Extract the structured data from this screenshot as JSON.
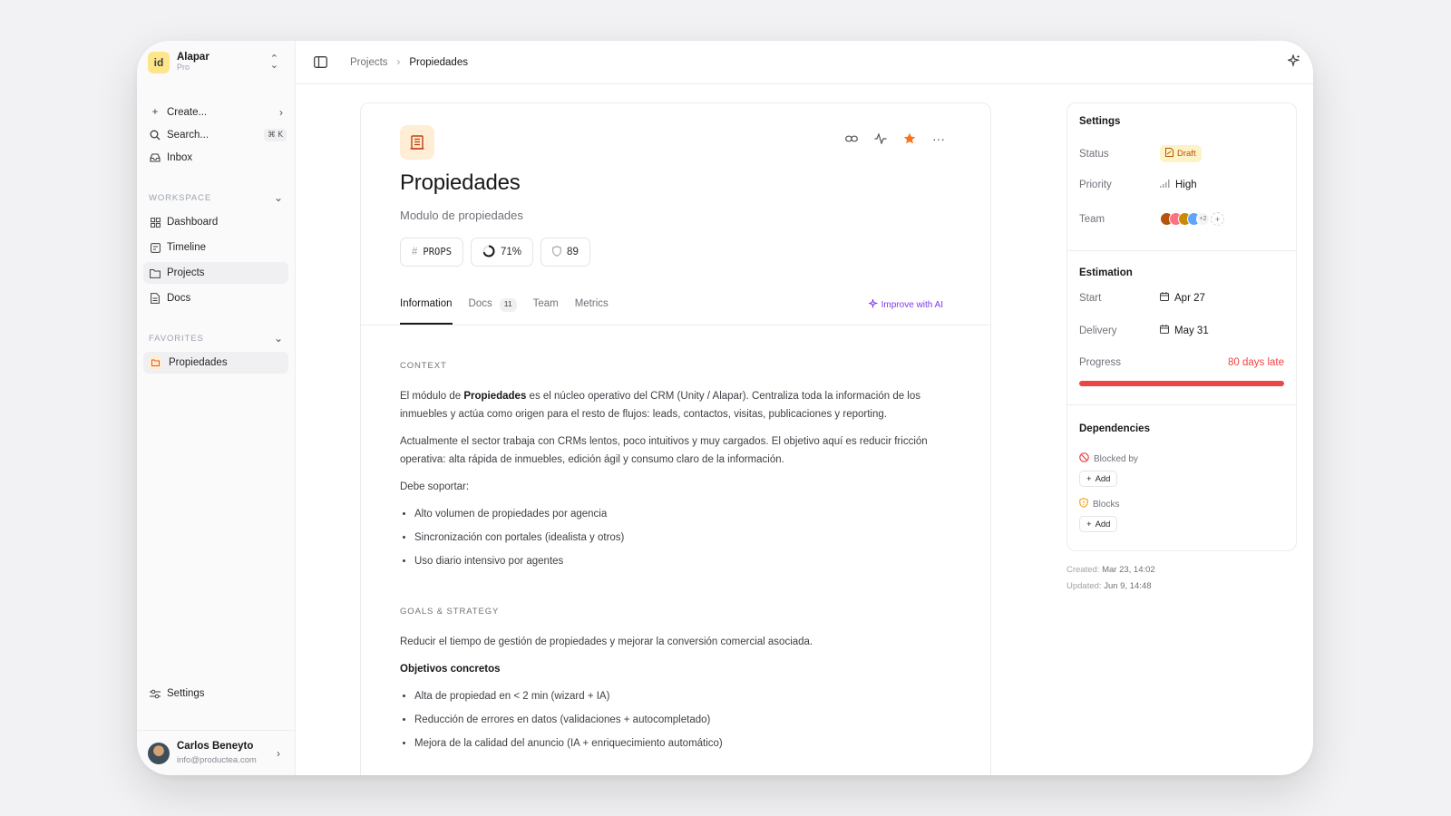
{
  "workspace": {
    "logo": "id",
    "name": "Alapar",
    "plan": "Pro"
  },
  "nav": {
    "create": "Create...",
    "search": "Search...",
    "search_kbd": "⌘ K",
    "inbox": "Inbox"
  },
  "workspace_section": {
    "label": "WORKSPACE",
    "items": [
      "Dashboard",
      "Timeline",
      "Projects",
      "Docs"
    ]
  },
  "favorites_section": {
    "label": "FAVORITES",
    "items": [
      "Propiedades"
    ]
  },
  "settings_label": "Settings",
  "user": {
    "name": "Carlos Beneyto",
    "email": "info@productea.com"
  },
  "breadcrumb": {
    "parent": "Projects",
    "current": "Propiedades"
  },
  "doc": {
    "title": "Propiedades",
    "subtitle": "Modulo de propiedades",
    "chips": {
      "code": "PROPS",
      "progress": "71%",
      "progress_value": 0.71,
      "score": "89"
    },
    "tabs": [
      {
        "label": "Information"
      },
      {
        "label": "Docs",
        "count": "11"
      },
      {
        "label": "Team"
      },
      {
        "label": "Metrics"
      }
    ],
    "improve": "Improve with AI",
    "context_heading": "CONTEXT",
    "p1_a": "El módulo de ",
    "p1_b": "Propiedades",
    "p1_c": " es el núcleo operativo del CRM (Unity / Alapar). Centraliza toda la información de los inmuebles y actúa como origen para el resto de flujos: leads, contactos, visitas, publicaciones y reporting.",
    "p2": "Actualmente el sector trabaja con CRMs lentos, poco intuitivos y muy cargados. El objetivo aquí es reducir fricción operativa: alta rápida de inmuebles, edición ágil y consumo claro de la información.",
    "p3": "Debe soportar:",
    "support": [
      "Alto volumen de propiedades por agencia",
      "Sincronización con portales (idealista y otros)",
      "Uso diario intensivo por agentes"
    ],
    "goals_heading": "GOALS & STRATEGY",
    "goals_p": "Reducir el tiempo de gestión de propiedades y mejorar la conversión comercial asociada.",
    "objectives_title": "Objetivos concretos",
    "objectives": [
      "Alta de propiedad en < 2 min (wizard + IA)",
      "Reducción de errores en datos (validaciones + autocompletado)",
      "Mejora de la calidad del anuncio (IA + enriquecimiento automático)"
    ]
  },
  "panel": {
    "settings_title": "Settings",
    "status_label": "Status",
    "status_value": "Draft",
    "priority_label": "Priority",
    "priority_value": "High",
    "team_label": "Team",
    "team_more": "+2",
    "team_add": "+",
    "estimation_title": "Estimation",
    "start_label": "Start",
    "start_value": "Apr 27",
    "delivery_label": "Delivery",
    "delivery_value": "May 31",
    "progress_label": "Progress",
    "progress_status": "80 days late",
    "dependencies_title": "Dependencies",
    "blocked_by": "Blocked by",
    "blocks": "Blocks",
    "add": "Add"
  },
  "meta": {
    "created_label": "Created:",
    "created_value": "Mar 23, 14:02",
    "updated_label": "Updated:",
    "updated_value": "Jun 9, 14:48"
  },
  "colors": {
    "accent_orange": "#f97316",
    "late_red": "#ef4444",
    "ai_purple": "#7c3aed",
    "draft_bg": "#fef3c7"
  }
}
